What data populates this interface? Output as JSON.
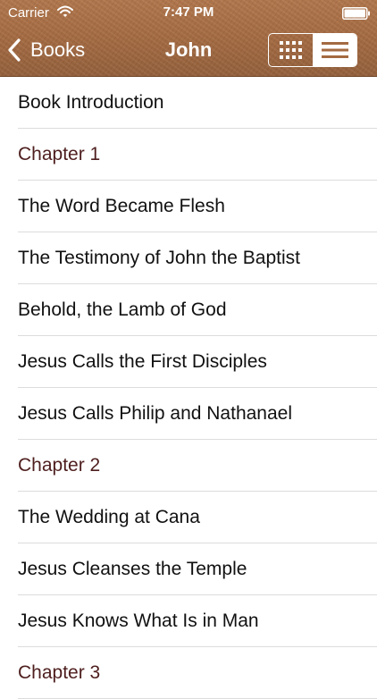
{
  "status_bar": {
    "carrier": "Carrier",
    "time": "7:47 PM"
  },
  "nav": {
    "back_label": "Books",
    "title": "John",
    "view_options": [
      "grid-icon",
      "list-icon"
    ],
    "selected_view": "list"
  },
  "colors": {
    "header_brown": "#a46a41",
    "chapter_text": "#4e1e1e",
    "item_text": "#111111"
  },
  "list": {
    "items": [
      {
        "label": "Book Introduction",
        "kind": "section"
      },
      {
        "label": "Chapter 1",
        "kind": "chapter"
      },
      {
        "label": "The Word Became Flesh",
        "kind": "section"
      },
      {
        "label": "The Testimony of John the Baptist",
        "kind": "section"
      },
      {
        "label": "Behold, the Lamb of God",
        "kind": "section"
      },
      {
        "label": "Jesus Calls the First Disciples",
        "kind": "section"
      },
      {
        "label": "Jesus Calls Philip and Nathanael",
        "kind": "section"
      },
      {
        "label": "Chapter 2",
        "kind": "chapter"
      },
      {
        "label": "The Wedding at Cana",
        "kind": "section"
      },
      {
        "label": "Jesus Cleanses the Temple",
        "kind": "section"
      },
      {
        "label": "Jesus Knows What Is in Man",
        "kind": "section"
      },
      {
        "label": "Chapter 3",
        "kind": "chapter"
      }
    ]
  }
}
